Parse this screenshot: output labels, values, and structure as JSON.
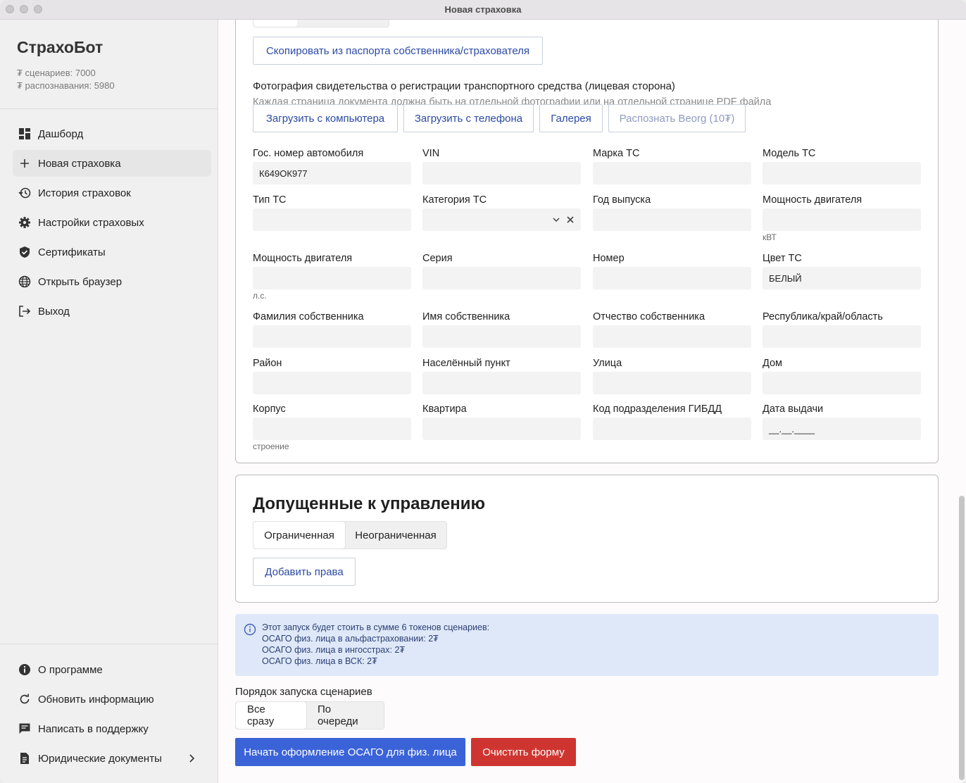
{
  "window": {
    "title": "Новая страховка"
  },
  "sidebar": {
    "brand": "СтрахоБот",
    "stats": [
      "₮ сценариев: 7000",
      "₮ распознавания: 5980"
    ],
    "items": [
      {
        "label": "Дашборд",
        "icon": "dashboard-icon"
      },
      {
        "label": "Новая страховка",
        "icon": "plus-icon",
        "active": true
      },
      {
        "label": "История страховок",
        "icon": "history-icon"
      },
      {
        "label": "Настройки страховых",
        "icon": "gear-icon"
      },
      {
        "label": "Сертификаты",
        "icon": "shield-icon"
      },
      {
        "label": "Открыть браузер",
        "icon": "globe-icon"
      },
      {
        "label": "Выход",
        "icon": "logout-icon"
      }
    ],
    "bottom_items": [
      {
        "label": "О программе",
        "icon": "info-icon"
      },
      {
        "label": "Обновить информацию",
        "icon": "refresh-icon"
      },
      {
        "label": "Написать в поддержку",
        "icon": "chat-icon"
      },
      {
        "label": "Юридические документы",
        "icon": "document-icon"
      }
    ]
  },
  "vehicle": {
    "copy_button": "Скопировать из паспорта собственника/страхователя",
    "photo_title": "Фотография свидетельства о регистрации транспортного средства (лицевая сторона)",
    "photo_hint": "Каждая страница документа должна быть на отдельной фотографии или на отдельной странице PDF файла",
    "upload_buttons": [
      "Загрузить с компьютера",
      "Загрузить с телефона",
      "Галерея",
      "Распознать Beorg (10₮)"
    ],
    "fields": [
      {
        "label": "Гос. номер автомобиля",
        "value": "К649ОК977"
      },
      {
        "label": "VIN",
        "value": ""
      },
      {
        "label": "Марка ТС",
        "value": ""
      },
      {
        "label": "Модель ТС",
        "value": ""
      },
      {
        "label": "Тип ТС",
        "value": ""
      },
      {
        "label": "Категория ТС",
        "value": ""
      },
      {
        "label": "Год выпуска",
        "value": ""
      },
      {
        "label": "Мощность двигателя",
        "value": "",
        "sub": "кВТ"
      },
      {
        "label": "Мощность двигателя",
        "value": "",
        "sub": "л.с."
      },
      {
        "label": "Серия",
        "value": ""
      },
      {
        "label": "Номер",
        "value": ""
      },
      {
        "label": "Цвет ТС",
        "value": "БЕЛЫЙ"
      },
      {
        "label": "Фамилия собственника",
        "value": ""
      },
      {
        "label": "Имя собственника",
        "value": ""
      },
      {
        "label": "Отчество собственника",
        "value": ""
      },
      {
        "label": "Республика/край/область",
        "value": ""
      },
      {
        "label": "Район",
        "value": ""
      },
      {
        "label": "Населённый пункт",
        "value": ""
      },
      {
        "label": "Улица",
        "value": ""
      },
      {
        "label": "Дом",
        "value": ""
      },
      {
        "label": "Корпус",
        "value": "",
        "sub": "строение"
      },
      {
        "label": "Квартира",
        "value": ""
      },
      {
        "label": "Код подразделения ГИБДД",
        "value": ""
      },
      {
        "label": "Дата выдачи",
        "value": "__.__.____"
      }
    ]
  },
  "drivers": {
    "title": "Допущенные к управлению",
    "options": [
      "Ограниченная",
      "Неограниченная"
    ],
    "selected": "Ограниченная",
    "add_button": "Добавить права"
  },
  "info": {
    "lines": [
      "Этот запуск будет стоить в сумме 6 токенов сценариев:",
      "ОСАГО физ. лица в альфастраховании: 2₮",
      "ОСАГО физ. лица в ингосстрах: 2₮",
      "ОСАГО физ. лица в ВСК: 2₮"
    ]
  },
  "run_order": {
    "label": "Порядок запуска сценариев",
    "options": [
      "Все сразу",
      "По очереди"
    ],
    "selected": "Все сразу"
  },
  "actions": {
    "start": "Начать оформление ОСАГО для физ. лица",
    "clear": "Очистить форму"
  },
  "colors": {
    "primary": "#3b63d8",
    "danger": "#cf3530",
    "link": "#2b4aa3",
    "info_bg": "#dfe8f8"
  }
}
